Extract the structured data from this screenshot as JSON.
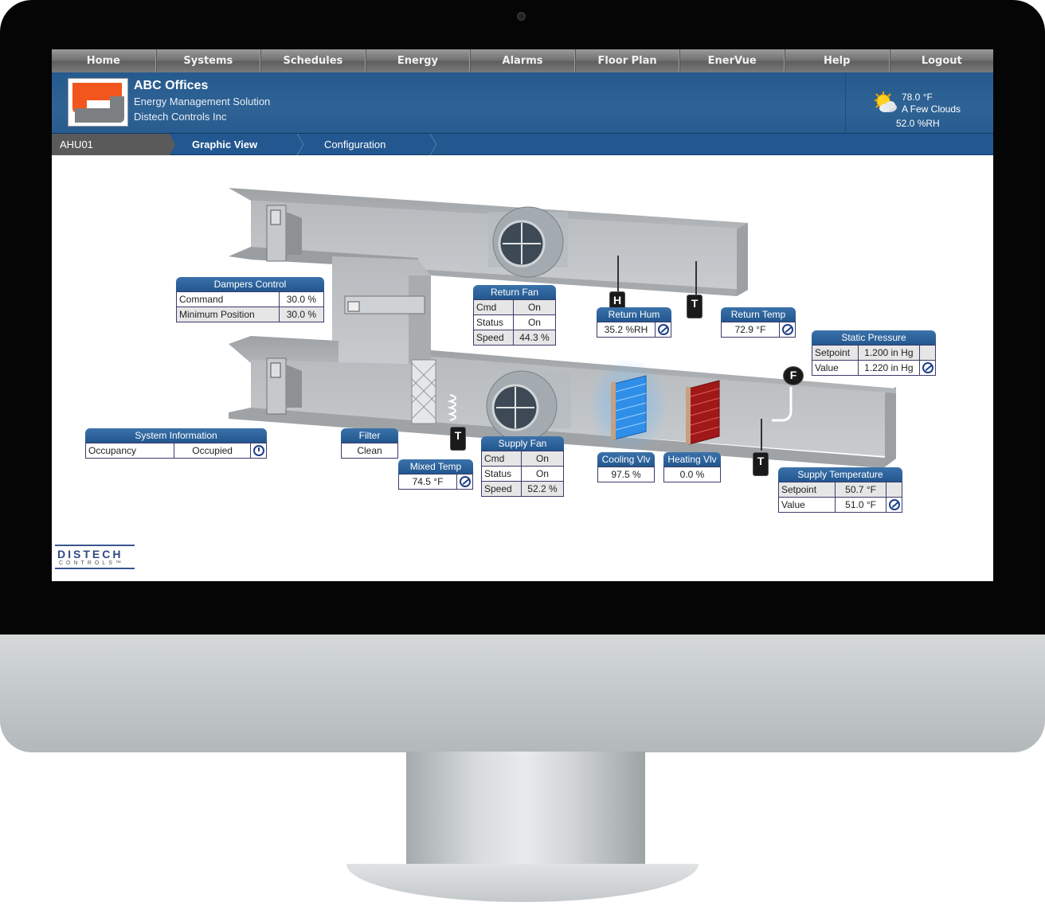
{
  "nav": {
    "items": [
      {
        "label": "Home"
      },
      {
        "label": "Systems"
      },
      {
        "label": "Schedules"
      },
      {
        "label": "Energy"
      },
      {
        "label": "Alarms"
      },
      {
        "label": "Floor Plan"
      },
      {
        "label": "EnerVue"
      },
      {
        "label": "Help"
      },
      {
        "label": "Logout"
      }
    ]
  },
  "header": {
    "title": "ABC Offices",
    "subtitle": "Energy Management Solution",
    "company": "Distech Controls Inc",
    "weather": {
      "icon": "partly-cloudy-icon",
      "temperature": "78.0 °F",
      "condition": "A Few Clouds",
      "humidity": "52.0 %RH"
    }
  },
  "breadcrumb": {
    "root": "AHU01",
    "active": "Graphic View",
    "next": "Configuration"
  },
  "widgets": {
    "dampers": {
      "title": "Dampers Control",
      "rows": [
        {
          "label": "Command",
          "value": "30.0 %"
        },
        {
          "label": "Minimum Position",
          "value": "30.0 %"
        }
      ]
    },
    "return_fan": {
      "title": "Return Fan",
      "rows": [
        {
          "label": "Cmd",
          "value": "On"
        },
        {
          "label": "Status",
          "value": "On"
        },
        {
          "label": "Speed",
          "value": "44.3 %"
        }
      ]
    },
    "return_hum": {
      "title": "Return Hum",
      "value": "35.2 %RH",
      "sensor": "H"
    },
    "return_temp": {
      "title": "Return Temp",
      "value": "72.9 °F",
      "sensor": "T"
    },
    "static_pressure": {
      "title": "Static Pressure",
      "rows": [
        {
          "label": "Setpoint",
          "value": "1.200 in Hg"
        },
        {
          "label": "Value",
          "value": "1.220 in Hg"
        }
      ],
      "sensor": "F"
    },
    "system_info": {
      "title": "System Information",
      "rows": [
        {
          "label": "Occupancy",
          "value": "Occupied"
        }
      ]
    },
    "filter": {
      "title": "Filter",
      "value": "Clean"
    },
    "mixed_temp": {
      "title": "Mixed Temp",
      "value": "74.5 °F",
      "sensor": "T"
    },
    "supply_fan": {
      "title": "Supply Fan",
      "rows": [
        {
          "label": "Cmd",
          "value": "On"
        },
        {
          "label": "Status",
          "value": "On"
        },
        {
          "label": "Speed",
          "value": "52.2 %"
        }
      ]
    },
    "cooling_vlv": {
      "title": "Cooling Vlv",
      "value": "97.5 %"
    },
    "heating_vlv": {
      "title": "Heating Vlv",
      "value": "0.0 %"
    },
    "supply_temp": {
      "title": "Supply Temperature",
      "rows": [
        {
          "label": "Setpoint",
          "value": "50.7 °F"
        },
        {
          "label": "Value",
          "value": "51.0 °F"
        }
      ],
      "sensor": "T"
    }
  },
  "footer_logo": {
    "main": "DISTECH",
    "sub": "CONTROLS™"
  },
  "colors": {
    "header_blue": "#2a5d91",
    "panel_header": "#22578e",
    "logo_orange": "#f2561d",
    "cooling_coil": "#2f8fe8",
    "heating_coil": "#a11818"
  }
}
